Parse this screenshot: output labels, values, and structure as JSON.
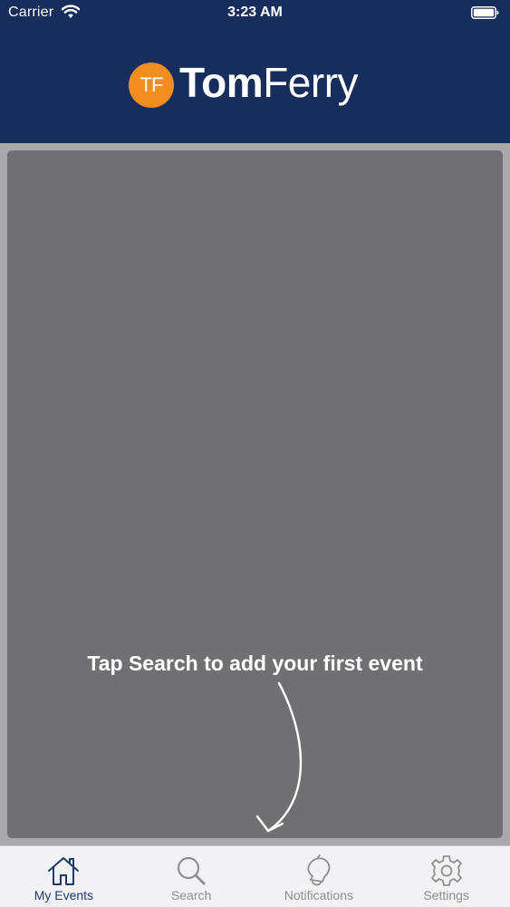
{
  "status_bar": {
    "carrier": "Carrier",
    "time": "3:23 AM"
  },
  "header": {
    "logo_badge": "TF",
    "logo_name_bold": "Tom",
    "logo_name_light": "Ferry"
  },
  "main": {
    "empty_hint": "Tap Search to add your first event"
  },
  "tabs": [
    {
      "label": "My Events",
      "icon": "home-icon",
      "active": true
    },
    {
      "label": "Search",
      "icon": "search-icon",
      "active": false
    },
    {
      "label": "Notifications",
      "icon": "bell-icon",
      "active": false
    },
    {
      "label": "Settings",
      "icon": "gear-icon",
      "active": false
    }
  ],
  "colors": {
    "header_bg": "#172e5c",
    "logo_orange": "#f28d1f",
    "card_bg": "#707073",
    "tab_active": "#1f3a6b",
    "tab_inactive": "#8e8e93"
  }
}
